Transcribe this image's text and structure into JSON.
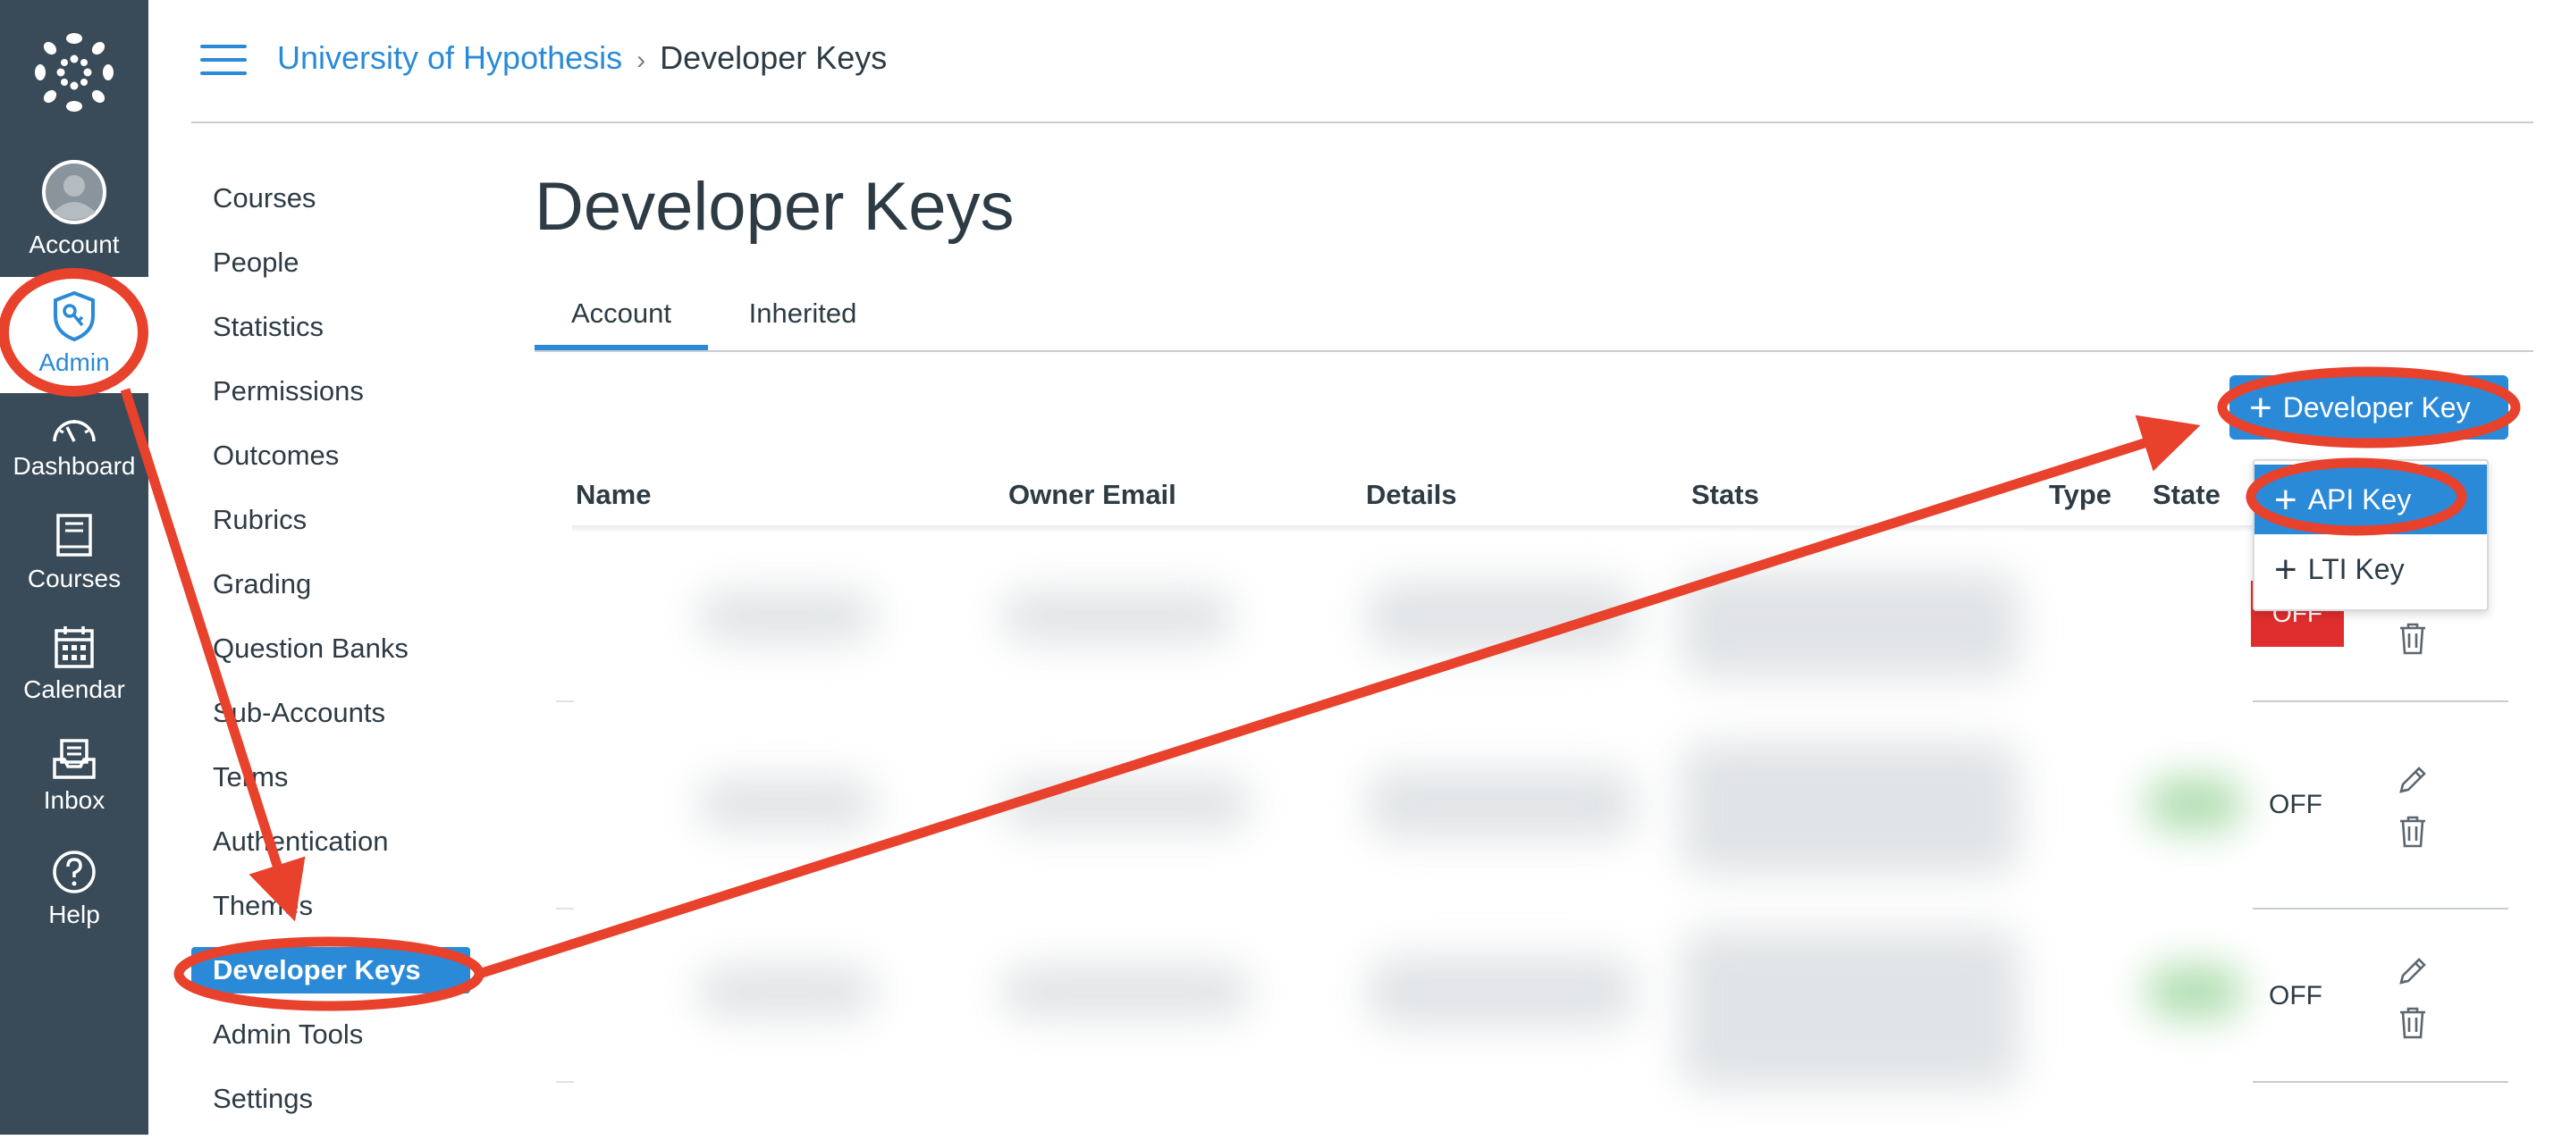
{
  "global_nav": {
    "account": "Account",
    "admin": "Admin",
    "dashboard": "Dashboard",
    "courses": "Courses",
    "calendar": "Calendar",
    "inbox": "Inbox",
    "help": "Help"
  },
  "breadcrumb": {
    "root": "University of Hypothesis",
    "current": "Developer Keys"
  },
  "subnav": {
    "items": [
      "Courses",
      "People",
      "Statistics",
      "Permissions",
      "Outcomes",
      "Rubrics",
      "Grading",
      "Question Banks",
      "Sub-Accounts",
      "Terms",
      "Authentication",
      "Themes",
      "Developer Keys",
      "Admin Tools",
      "Settings"
    ],
    "active": "Developer Keys"
  },
  "page": {
    "title": "Developer Keys",
    "tabs": [
      "Account",
      "Inherited"
    ],
    "active_tab": "Account",
    "add_button_label": "Developer Key"
  },
  "dropdown": {
    "items": [
      "API Key",
      "LTI Key"
    ],
    "highlighted": "API Key"
  },
  "table": {
    "columns": [
      "Name",
      "Owner Email",
      "Details",
      "Stats",
      "Type",
      "State"
    ],
    "rows": [
      {
        "state": "OFF"
      },
      {
        "state": "OFF"
      },
      {
        "state": "OFF"
      }
    ]
  },
  "colors": {
    "nav_bg": "#394b58",
    "accent": "#2b8ad8",
    "annotation": "#e8412c",
    "off_red": "#e02d2d"
  },
  "icons": [
    "canvas-logo-icon",
    "account-avatar-icon",
    "admin-shield-icon",
    "dashboard-gauge-icon",
    "courses-book-icon",
    "calendar-icon",
    "inbox-icon",
    "help-icon",
    "hamburger-icon",
    "plus-icon",
    "pencil-icon",
    "trash-icon"
  ]
}
